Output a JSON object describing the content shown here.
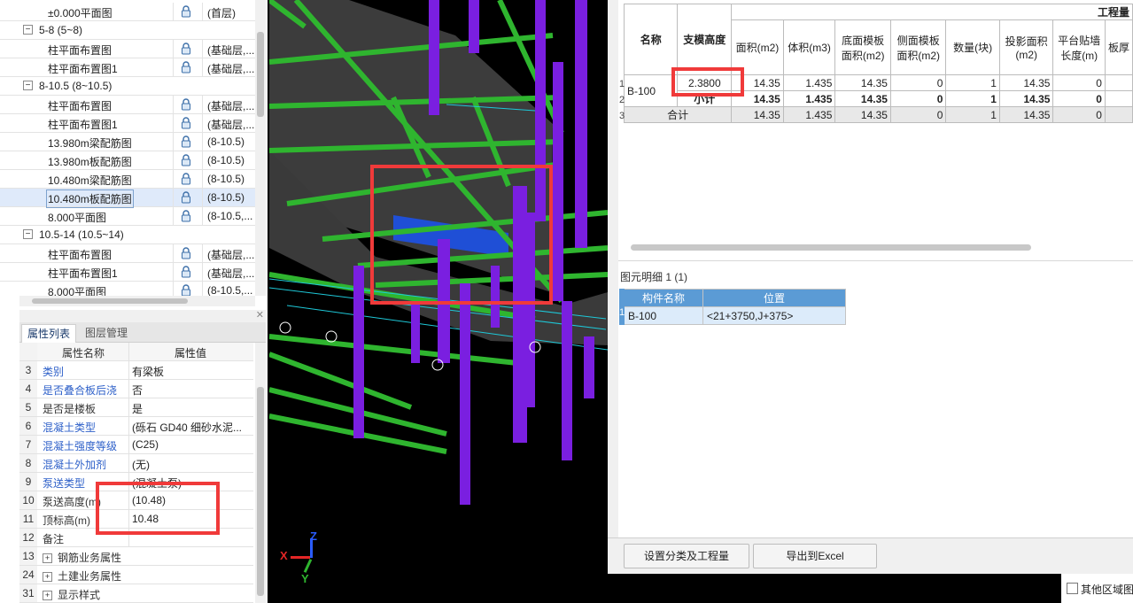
{
  "tree": {
    "rows": [
      {
        "type": "leaf",
        "name": "±0.000平面图",
        "layer": "(首层)"
      },
      {
        "type": "group",
        "toggle": "−",
        "name": "5-8 (5~8)"
      },
      {
        "type": "leaf",
        "name": "柱平面布置图",
        "layer": "(基础层,..."
      },
      {
        "type": "leaf",
        "name": "柱平面布置图1",
        "layer": "(基础层,..."
      },
      {
        "type": "group",
        "toggle": "−",
        "name": "8-10.5 (8~10.5)"
      },
      {
        "type": "leaf",
        "name": "柱平面布置图",
        "layer": "(基础层,..."
      },
      {
        "type": "leaf",
        "name": "柱平面布置图1",
        "layer": "(基础层,..."
      },
      {
        "type": "leaf",
        "name": "13.980m梁配筋图",
        "layer": "(8-10.5)"
      },
      {
        "type": "leaf",
        "name": "13.980m板配筋图",
        "layer": "(8-10.5)"
      },
      {
        "type": "leaf",
        "name": "10.480m梁配筋图",
        "layer": "(8-10.5)"
      },
      {
        "type": "leaf",
        "name": "10.480m板配筋图",
        "layer": "(8-10.5)",
        "selected": true
      },
      {
        "type": "leaf",
        "name": "8.000平面图",
        "layer": "(8-10.5,..."
      },
      {
        "type": "group",
        "toggle": "−",
        "name": "10.5-14 (10.5~14)"
      },
      {
        "type": "leaf",
        "name": "柱平面布置图",
        "layer": "(基础层,..."
      },
      {
        "type": "leaf",
        "name": "柱平面布置图1",
        "layer": "(基础层,..."
      },
      {
        "type": "leaf",
        "name": "8.000平面图",
        "layer": "(8-10.5,..."
      }
    ]
  },
  "props": {
    "tabs": [
      "属性列表",
      "图层管理"
    ],
    "header": {
      "name": "属性名称",
      "value": "属性值"
    },
    "rows": [
      {
        "num": "3",
        "name": "类别",
        "value": "有梁板",
        "link": true
      },
      {
        "num": "4",
        "name": "是否叠合板后浇",
        "value": "否",
        "link": true
      },
      {
        "num": "5",
        "name": "是否是楼板",
        "value": "是",
        "link": false
      },
      {
        "num": "6",
        "name": "混凝土类型",
        "value": "(砾石 GD40 细砂水泥...",
        "link": true
      },
      {
        "num": "7",
        "name": "混凝土强度等级",
        "value": "(C25)",
        "link": true
      },
      {
        "num": "8",
        "name": "混凝土外加剂",
        "value": "(无)",
        "link": true
      },
      {
        "num": "9",
        "name": "泵送类型",
        "value": "(混凝土泵)",
        "link": true
      },
      {
        "num": "10",
        "name": "泵送高度(m)",
        "value": "(10.48)",
        "link": false
      },
      {
        "num": "11",
        "name": "顶标高(m)",
        "value": "10.48",
        "link": false
      },
      {
        "num": "12",
        "name": "备注",
        "value": "",
        "link": false
      },
      {
        "num": "13",
        "name": "钢筋业务属性",
        "value": "",
        "link": false,
        "expand": true
      },
      {
        "num": "24",
        "name": "土建业务属性",
        "value": "",
        "link": false,
        "expand": true
      },
      {
        "num": "31",
        "name": "显示样式",
        "value": "",
        "link": false,
        "expand": true
      }
    ]
  },
  "axes": {
    "x": "X",
    "y": "Y",
    "z": "Z"
  },
  "quantity": {
    "group_header": "工程量",
    "headers": [
      "名称",
      "支模高度",
      "面积(m2)",
      "体积(m3)",
      "底面模板面积(m2)",
      "侧面模板面积(m2)",
      "数量(块)",
      "投影面积(m2)",
      "平台贴墙长度(m)",
      "板厚"
    ],
    "row_numbers": [
      "1",
      "2",
      "3"
    ],
    "name": "B-100",
    "row1": {
      "height": "2.3800",
      "area": "14.35",
      "volume": "1.435",
      "bottom": "14.35",
      "side": "0",
      "count": "1",
      "proj": "14.35",
      "wall": "0"
    },
    "subtotal": {
      "label": "小计",
      "area": "14.35",
      "volume": "1.435",
      "bottom": "14.35",
      "side": "0",
      "count": "1",
      "proj": "14.35",
      "wall": "0"
    },
    "total": {
      "label": "合计",
      "area": "14.35",
      "volume": "1.435",
      "bottom": "14.35",
      "side": "0",
      "count": "1",
      "proj": "14.35",
      "wall": "0"
    }
  },
  "detail": {
    "title": "图元明细",
    "count": "1 (1)",
    "headers": [
      "构件名称",
      "位置"
    ],
    "row_number": "1",
    "row": {
      "name": "B-100",
      "pos": "<21+3750,J+375>"
    }
  },
  "buttons": {
    "settings": "设置分类及工程量",
    "export": "导出到Excel"
  },
  "other_area": "其他区域图",
  "colors": {
    "accent": "#5b9bd5",
    "highlight": "#f03a3a",
    "beam": "#2fb52f",
    "column": "#7a1fe0",
    "slab": "#3c3c3c",
    "selected_slab": "#1f4fd6"
  }
}
